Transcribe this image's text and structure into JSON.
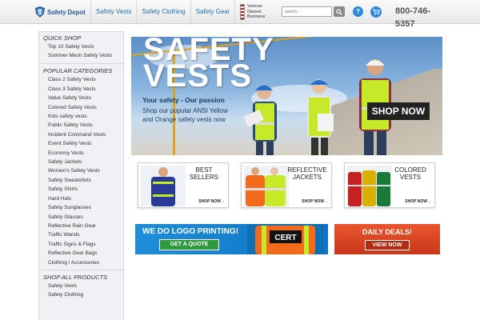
{
  "header": {
    "logo_text": "Safety Depot",
    "nav": [
      "Safety Vests",
      "Safety Clothing",
      "Safety Gear"
    ],
    "veteran_text": [
      "Veteran",
      "Owned",
      "Business"
    ],
    "search_placeholder": "search...",
    "help_label": "?",
    "phone": "800-746-5357"
  },
  "sidebar": {
    "quick_shop_heading": "QUICK SHOP",
    "quick_shop": [
      "Top 10 Safety Vests",
      "Summer Mesh Safety Vests"
    ],
    "popular_heading": "POPULAR CATEGORIES",
    "popular": [
      "Class 2 Safety Vests",
      "Class 3 Safety Vests",
      "Value Safety Vests",
      "Colored Safety Vests",
      "Kids safety vests",
      "Public Safety Vests",
      "Incident Command Vests",
      "Event Safety Vests",
      "Economy Vests",
      "Safety Jackets",
      "Women's Safety Vests",
      "Safety Sweatshirts",
      "Safety Shirts",
      "Hard Hats",
      "Safety Sunglasses",
      "Safety Glasses",
      "Reflective Rain Gear",
      "Traffic Wands",
      "Traffic Signs & Flags",
      "Reflective Gear Bags",
      "Clothing / Accessories"
    ],
    "all_heading": "SHOP ALL PRODUCTS",
    "all": [
      "Safety Vests",
      "Safety Clothing"
    ]
  },
  "hero": {
    "title_line1": "SAFETY",
    "title_line2": "VESTS",
    "tagline": "Your safety - Our passion",
    "subtext": "Shop our popular ANSI Yellow and Orange safety vests now",
    "cta": "SHOP NOW"
  },
  "cards": [
    {
      "title": "BEST SELLERS",
      "cta": "SHOP NOW→"
    },
    {
      "title": "REFLECTIVE JACKETS",
      "cta": "SHOP NOW→"
    },
    {
      "title": "COLORED VESTS",
      "cta": "SHOP NOW→"
    }
  ],
  "logo_banner": {
    "title": "WE DO LOGO PRINTING!",
    "button": "GET A QUOTE",
    "vest_text": "CERT"
  },
  "deals_banner": {
    "title": "DAILY DEALS!",
    "button": "VIEW NOW"
  },
  "colors": {
    "brand_blue": "#1f6fb2",
    "hi_vis_yellow": "#c6ea2a",
    "hi_vis_orange": "#f26a1b",
    "deals_red": "#d9431f",
    "quote_green": "#2f9a3c"
  },
  "icons": [
    "shield-logo-icon",
    "flag-icon",
    "search-icon",
    "help-icon",
    "cart-icon",
    "arrow-right-icon"
  ]
}
